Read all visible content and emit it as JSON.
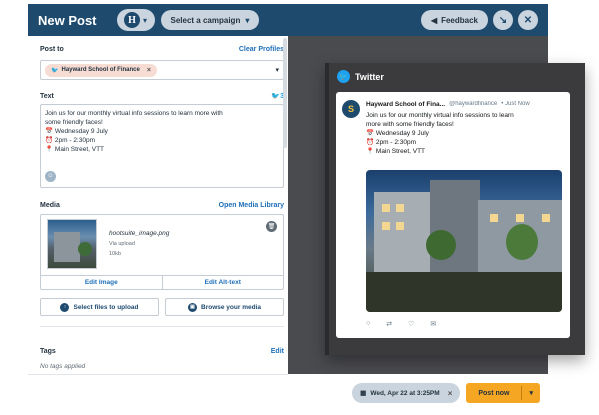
{
  "header": {
    "title": "New Post",
    "brand_logo_letter": "H",
    "campaign_label": "Select a campaign",
    "feedback_label": "Feedback",
    "color": "#1e4a6e"
  },
  "post_to": {
    "label": "Post to",
    "clear_label": "Clear Profiles",
    "profile_chip": "Hayward School of Finance"
  },
  "text": {
    "label": "Text",
    "count": "3",
    "line1": "Join us for our monthly virtual info sessions to learn more with",
    "line2": "some friendly faces!",
    "line3": "📅 Wednesday 9 July",
    "line4": "⏰ 2pm - 2:30pm",
    "line5": "📍 Main Street, VTT"
  },
  "media": {
    "label": "Media",
    "library_label": "Open Media Library",
    "filename": "hootsuite_image.png",
    "via": "Via upload",
    "size": "10kb",
    "edit_image": "Edit Image",
    "edit_alt": "Edit Alt-text",
    "select_files": "Select files to upload",
    "browse": "Browse your media"
  },
  "tags": {
    "label": "Tags",
    "edit_label": "Edit",
    "empty": "No tags applied"
  },
  "preview": {
    "network": "Twitter",
    "name": "Hayward School of Fina...",
    "handle": "@haywardfinance",
    "time": "• Just Now",
    "avatar_letter": "S",
    "body1": "Join us for our monthly virtual info sessions to learn",
    "body2": "more with some friendly faces!",
    "body3": "📅 Wednesday 9 July",
    "body4": "⏰ 2pm - 2:30pm",
    "body5": "📍 Main Street, VTT"
  },
  "footer": {
    "schedule": "Wed, Apr 22 at 3:25PM",
    "post_now": "Post now",
    "accent": "#f5a623"
  }
}
